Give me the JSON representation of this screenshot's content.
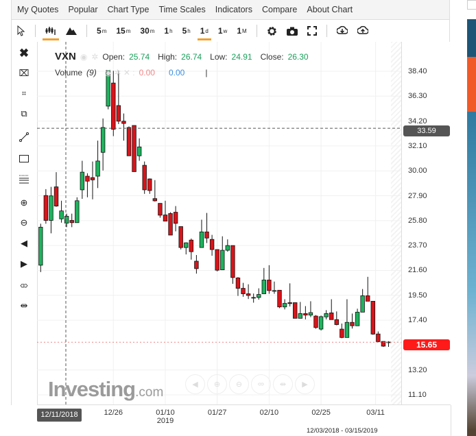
{
  "menu": [
    "My Quotes",
    "Popular",
    "Chart Type",
    "Time Scales",
    "Indicators",
    "Compare",
    "About Chart"
  ],
  "toolbar": {
    "timescales": [
      {
        "n": "5",
        "s": "m"
      },
      {
        "n": "15",
        "s": "m"
      },
      {
        "n": "30",
        "s": "m"
      },
      {
        "n": "1",
        "s": "h"
      },
      {
        "n": "5",
        "s": "h"
      },
      {
        "n": "1",
        "s": "d"
      },
      {
        "n": "1",
        "s": "w"
      },
      {
        "n": "1",
        "s": "M"
      }
    ],
    "active_timescale": "1d"
  },
  "info": {
    "symbol": "VXN",
    "open_label": "Open:",
    "open": "25.74",
    "high_label": "High:",
    "high": "26.74",
    "low_label": "Low:",
    "low": "24.91",
    "close_label": "Close:",
    "close": "26.30"
  },
  "volume": {
    "label": "Volume",
    "period": "(9)",
    "v1": "0.00",
    "v2": "0.00",
    "sep": "|"
  },
  "crosshair": {
    "price": "33.59",
    "date": "12/11/2018"
  },
  "last_price": "15.65",
  "date_range": "12/03/2018 - 03/15/2019",
  "watermark": {
    "brand": "Investing",
    "suffix": ".com"
  },
  "colors": {
    "up": "#1eb35d",
    "down": "#d9141a",
    "last": "#ff1a1a",
    "crosshair_badge": "#555555"
  },
  "chart_data": {
    "type": "candlestick",
    "ylim": [
      9.8,
      41.0
    ],
    "y_ticks": [
      "38.40",
      "36.30",
      "34.20",
      "32.10",
      "30.00",
      "27.90",
      "25.80",
      "23.70",
      "21.60",
      "19.50",
      "17.40",
      "13.20",
      "11.10"
    ],
    "x_ticks": [
      {
        "label": "12/26",
        "i": 14
      },
      {
        "label": "01/10",
        "sub": "2019",
        "i": 24
      },
      {
        "label": "01/27",
        "i": 34
      },
      {
        "label": "02/10",
        "i": 44
      },
      {
        "label": "02/25",
        "i": 54
      },
      {
        "label": "03/11",
        "i": 64.5
      }
    ],
    "ohlc": [
      [
        22.04,
        25.54,
        21.46,
        25.25
      ],
      [
        27.92,
        28.46,
        25.54,
        25.82
      ],
      [
        25.82,
        28.65,
        24.73,
        27.89
      ],
      [
        28.65,
        29.89,
        26.97,
        27.03
      ],
      [
        25.95,
        27.48,
        25.63,
        26.62
      ],
      [
        25.59,
        26.39,
        25.25,
        26.17
      ],
      [
        25.82,
        26.39,
        25.25,
        25.63
      ],
      [
        25.63,
        27.77,
        25.63,
        27.48
      ],
      [
        28.4,
        30.85,
        27.64,
        29.89
      ],
      [
        29.55,
        29.8,
        27.77,
        29.13
      ],
      [
        29.43,
        30.79,
        27.6,
        29.24
      ],
      [
        29.55,
        32.55,
        28.55,
        30.83
      ],
      [
        31.56,
        34.42,
        30.03,
        33.66
      ],
      [
        35.46,
        38.48,
        35.19,
        38.48
      ],
      [
        37.41,
        38.44,
        32.93,
        33.51
      ],
      [
        35.51,
        38.44,
        33.95,
        34.19
      ],
      [
        34.19,
        34.84,
        32.55,
        34.0
      ],
      [
        33.66,
        33.75,
        31.27,
        31.27
      ],
      [
        33.83,
        33.83,
        29.93,
        29.93
      ],
      [
        31.27,
        32.74,
        30.85,
        32.02
      ],
      [
        30.47,
        30.79,
        28.06,
        28.4
      ],
      [
        29.32,
        29.36,
        28.06,
        28.34
      ],
      [
        27.66,
        29.22,
        27.41,
        27.47
      ],
      [
        27.26,
        27.26,
        26.05,
        26.26
      ],
      [
        26.28,
        27.48,
        25.76,
        25.76
      ],
      [
        26.4,
        26.51,
        24.58,
        24.58
      ],
      [
        26.51,
        27.03,
        24.9,
        25.57
      ],
      [
        25.3,
        25.3,
        23.37,
        23.53
      ],
      [
        23.53,
        23.97,
        22.95,
        23.93
      ],
      [
        24.16,
        24.29,
        22.51,
        23.18
      ],
      [
        22.38,
        22.9,
        21.33,
        21.75
      ],
      [
        23.53,
        25.88,
        23.53,
        24.85
      ],
      [
        24.85,
        26.45,
        23.91,
        24.33
      ],
      [
        24.22,
        24.6,
        22.84,
        23.36
      ],
      [
        23.36,
        23.36,
        21.52,
        21.62
      ],
      [
        21.65,
        24.48,
        21.65,
        23.3
      ],
      [
        23.3,
        24.22,
        23.18,
        23.7
      ],
      [
        23.7,
        23.7,
        20.47,
        21.0
      ],
      [
        20.97,
        21.04,
        19.45,
        20.09
      ],
      [
        20.09,
        20.55,
        19.38,
        19.63
      ],
      [
        19.63,
        20.43,
        19.19,
        19.49
      ],
      [
        19.32,
        19.65,
        18.88,
        19.32
      ],
      [
        19.32,
        20.09,
        19.13,
        19.57
      ],
      [
        19.63,
        21.81,
        19.63,
        20.79
      ],
      [
        20.79,
        22.04,
        19.63,
        19.9
      ],
      [
        19.9,
        20.66,
        19.63,
        19.9
      ],
      [
        19.93,
        19.93,
        18.42,
        18.52
      ],
      [
        18.52,
        19.17,
        18.31,
        18.82
      ],
      [
        18.88,
        20.51,
        18.56,
        18.8
      ],
      [
        18.88,
        18.88,
        17.56,
        17.56
      ],
      [
        17.56,
        18.94,
        17.56,
        17.96
      ],
      [
        17.96,
        18.59,
        17.47,
        17.83
      ],
      [
        17.83,
        19.0,
        17.66,
        18.04
      ],
      [
        17.75,
        17.83,
        16.68,
        16.78
      ],
      [
        16.65,
        17.79,
        16.53,
        17.7
      ],
      [
        17.68,
        18.25,
        17.47,
        17.96
      ],
      [
        18.02,
        19.17,
        17.45,
        17.45
      ],
      [
        17.45,
        18.14,
        16.97,
        17.03
      ],
      [
        16.65,
        17.12,
        15.88,
        15.94
      ],
      [
        15.94,
        19.17,
        15.94,
        17.22
      ],
      [
        17.22,
        17.96,
        16.7,
        16.93
      ],
      [
        16.93,
        18.37,
        16.93,
        18.08
      ],
      [
        18.08,
        20.03,
        18.08,
        19.46
      ],
      [
        19.46,
        21.06,
        19.0,
        19.0
      ],
      [
        19.0,
        19.0,
        16.17,
        16.23
      ],
      [
        16.24,
        16.45,
        15.54,
        15.59
      ],
      [
        15.61,
        15.61,
        15.15,
        15.21
      ],
      [
        15.56,
        15.63,
        15.15,
        15.56
      ]
    ]
  }
}
